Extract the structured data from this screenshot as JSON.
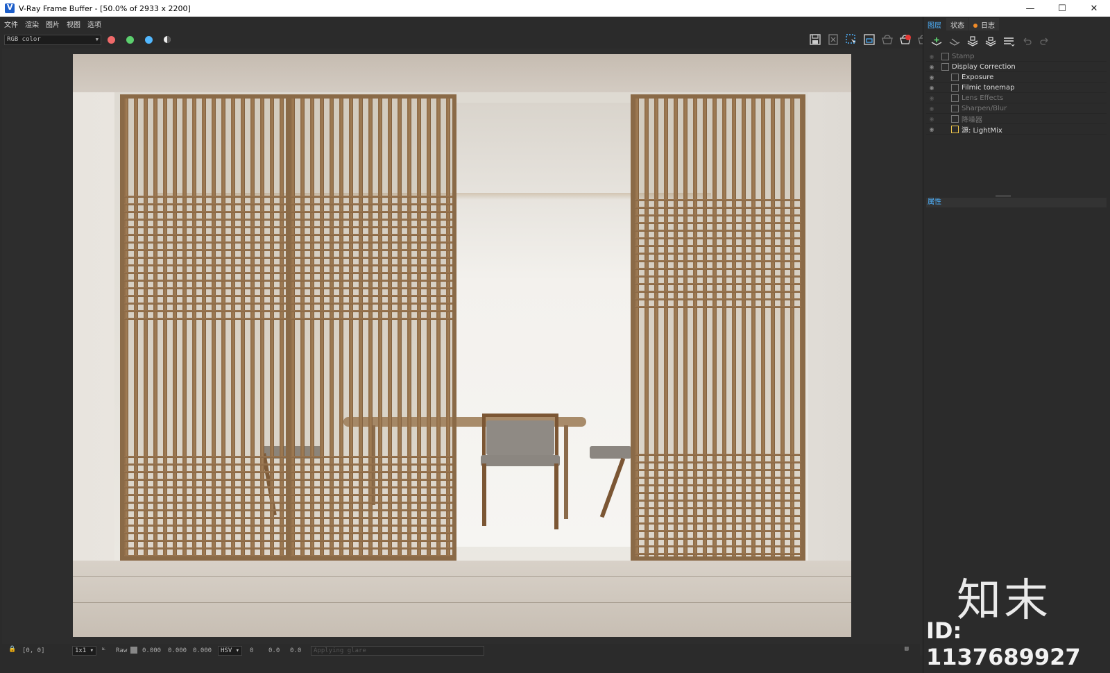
{
  "window": {
    "title": "V-Ray Frame Buffer - [50.0% of 2933 x 2200]",
    "controls": [
      "—",
      "☐",
      "✕"
    ]
  },
  "menu": [
    "文件",
    "渲染",
    "图片",
    "视图",
    "选项"
  ],
  "toolbar": {
    "channel": "RGB color",
    "channel_dots": [
      {
        "name": "red-channel-button",
        "color": "#f06a6a"
      },
      {
        "name": "green-channel-button",
        "color": "#5ccf6e"
      },
      {
        "name": "blue-channel-button",
        "color": "#52b8ff"
      }
    ],
    "right_icons": [
      "save-image-icon",
      "clear-image-icon",
      "region-render-icon",
      "compare-icon",
      "render-last-icon",
      "stop-render-icon",
      "render-icon"
    ]
  },
  "statusbar": {
    "coords": "[0, 0]",
    "zoom": "1x1",
    "mode": "Raw",
    "values_rgb": [
      "0.000",
      "0.000",
      "0.000"
    ],
    "color_space": "HSV",
    "values_hsv": [
      "0",
      "0.0",
      "0.0"
    ],
    "progress_text": "Applying glare"
  },
  "right_panel": {
    "tabs": [
      "图层",
      "状态",
      "日志"
    ],
    "active_tab": "图层",
    "layers": [
      {
        "label": "Stamp",
        "visible": false,
        "indent": 0
      },
      {
        "label": "Display Correction",
        "visible": true,
        "indent": 0
      },
      {
        "label": "Exposure",
        "visible": true,
        "indent": 1
      },
      {
        "label": "Filmic tonemap",
        "visible": true,
        "indent": 1
      },
      {
        "label": "Lens Effects",
        "visible": false,
        "indent": 1
      },
      {
        "label": "Sharpen/Blur",
        "visible": false,
        "indent": 1
      },
      {
        "label": "降噪器",
        "visible": false,
        "indent": 1
      },
      {
        "label": "源: LightMix",
        "visible": true,
        "indent": 1
      }
    ],
    "properties_header": "属性"
  },
  "watermark": {
    "brand": "知末",
    "id": "ID: 1137689927"
  }
}
